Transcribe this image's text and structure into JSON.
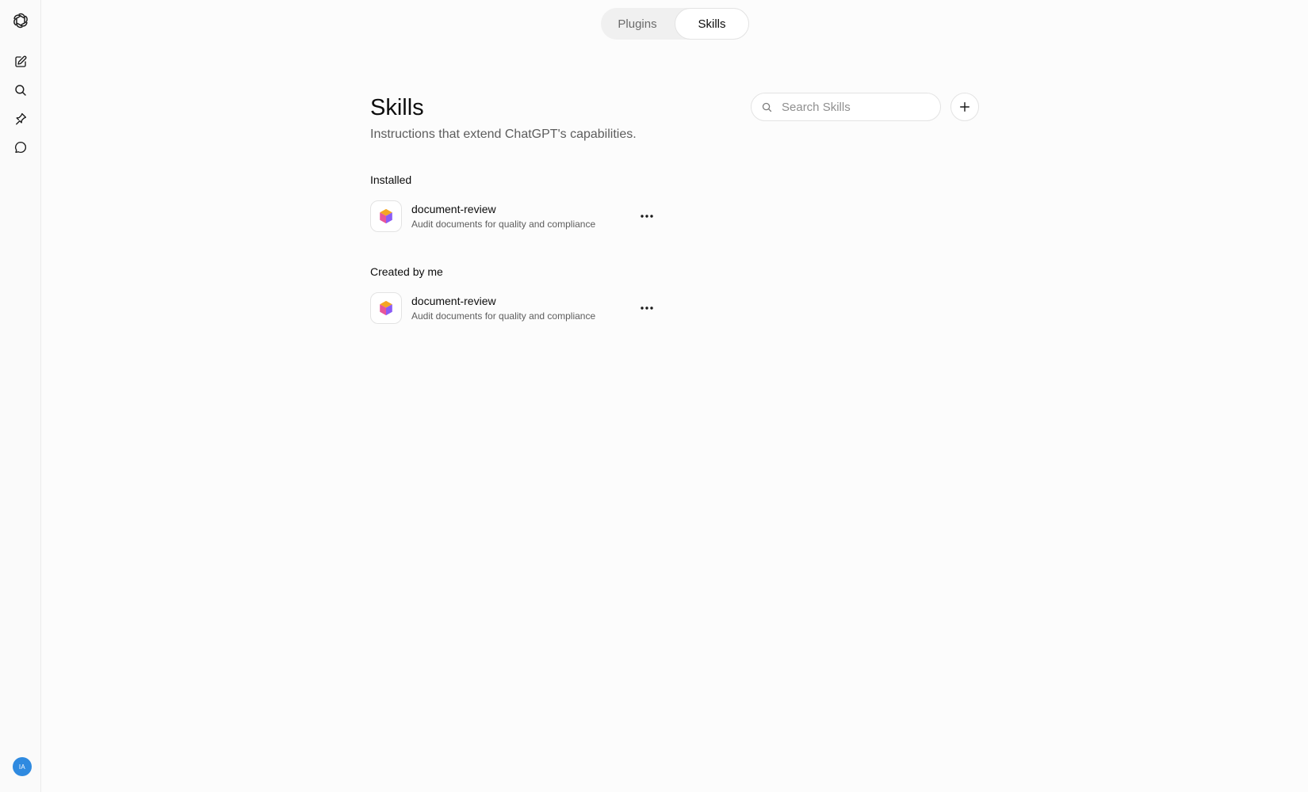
{
  "sidebar": {
    "icons": [
      "openai-logo-icon",
      "new-chat-icon",
      "search-icon",
      "pin-icon",
      "chat-bubble-icon"
    ],
    "avatar_initials": "IA",
    "avatar_color": "#2f8ae0"
  },
  "tabs": [
    {
      "label": "Plugins",
      "active": false
    },
    {
      "label": "Skills",
      "active": true
    }
  ],
  "header": {
    "title": "Skills",
    "subtitle": "Instructions that extend ChatGPT's capabilities."
  },
  "search": {
    "placeholder": "Search Skills",
    "value": ""
  },
  "sections": [
    {
      "heading": "Installed",
      "items": [
        {
          "name": "document-review",
          "description": "Audit documents for quality and compliance"
        }
      ]
    },
    {
      "heading": "Created by me",
      "items": [
        {
          "name": "document-review",
          "description": "Audit documents for quality and compliance"
        }
      ]
    }
  ],
  "colors": {
    "background": "#fcfcfc",
    "text_primary": "#0d0d0d",
    "text_secondary": "#5d5d5d",
    "border": "#e3e3e3",
    "skill_icon_orange": "#f5a623",
    "skill_icon_purple": "#8a5cf6",
    "skill_icon_pink": "#e8559a"
  }
}
